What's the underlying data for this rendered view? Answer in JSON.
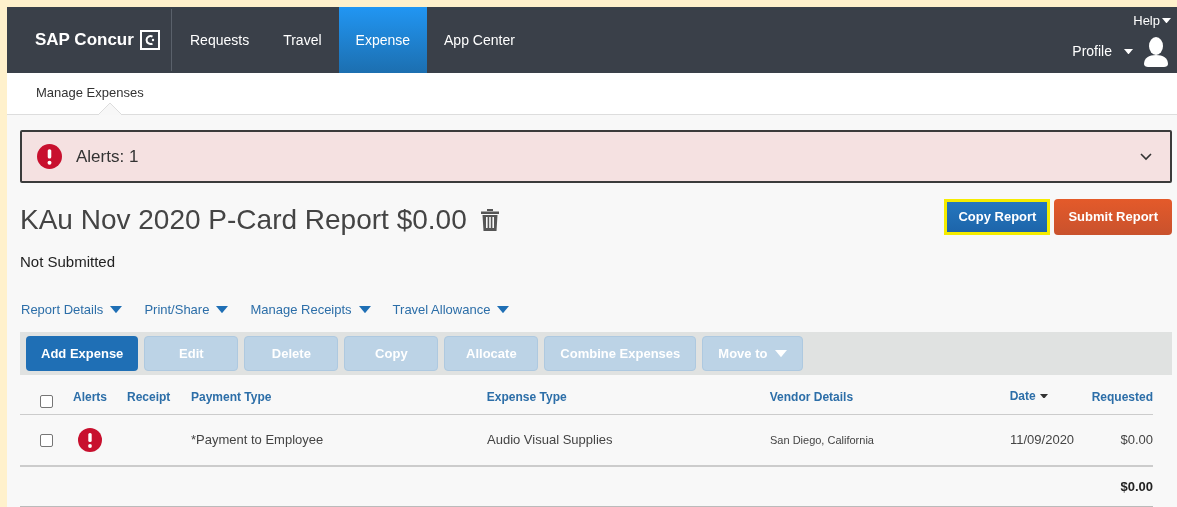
{
  "nav": {
    "logo": "SAP Concur",
    "tabs": [
      {
        "label": "Requests",
        "selected": false
      },
      {
        "label": "Travel",
        "selected": false
      },
      {
        "label": "Expense",
        "selected": true
      },
      {
        "label": "App Center",
        "selected": false
      }
    ],
    "help": "Help",
    "profile": "Profile"
  },
  "subnav": {
    "items": [
      {
        "label": "Manage Expenses",
        "selected": true
      }
    ]
  },
  "alerts": {
    "label": "Alerts: 1",
    "expanded": false
  },
  "report": {
    "title": "KAu Nov 2020 P-Card Report $0.00",
    "status": "Not Submitted",
    "actions": [
      {
        "label": "Copy Report",
        "kind": "primary",
        "highlighted": true
      },
      {
        "label": "Submit Report",
        "kind": "submit",
        "highlighted": false
      }
    ],
    "menus": [
      "Report Details",
      "Print/Share",
      "Manage Receipts",
      "Travel Allowance"
    ]
  },
  "toolbar": [
    {
      "label": "Add Expense",
      "disabled": false,
      "dropdown": false
    },
    {
      "label": "Edit",
      "disabled": true,
      "dropdown": false
    },
    {
      "label": "Delete",
      "disabled": true,
      "dropdown": false
    },
    {
      "label": "Copy",
      "disabled": true,
      "dropdown": false
    },
    {
      "label": "Allocate",
      "disabled": true,
      "dropdown": false
    },
    {
      "label": "Combine Expenses",
      "disabled": true,
      "dropdown": false
    },
    {
      "label": "Move to",
      "disabled": true,
      "dropdown": true
    }
  ],
  "table": {
    "select_all": false,
    "columns": [
      {
        "label": "Alerts",
        "sorted": false
      },
      {
        "label": "Receipt",
        "sorted": false
      },
      {
        "label": "Payment Type",
        "sorted": false
      },
      {
        "label": "Expense Type",
        "sorted": false
      },
      {
        "label": "Vendor Details",
        "sorted": false
      },
      {
        "label": "Date",
        "sorted": true
      },
      {
        "label": "Requested",
        "sorted": false
      }
    ],
    "rows": [
      {
        "checked": false,
        "alert": true,
        "payment_type": "*Payment to Employee",
        "expense_type": "Audio Visual Supplies",
        "vendor": "San Diego, California",
        "date": "11/09/2020",
        "requested": "$0.00"
      }
    ],
    "total": "$0.00"
  }
}
